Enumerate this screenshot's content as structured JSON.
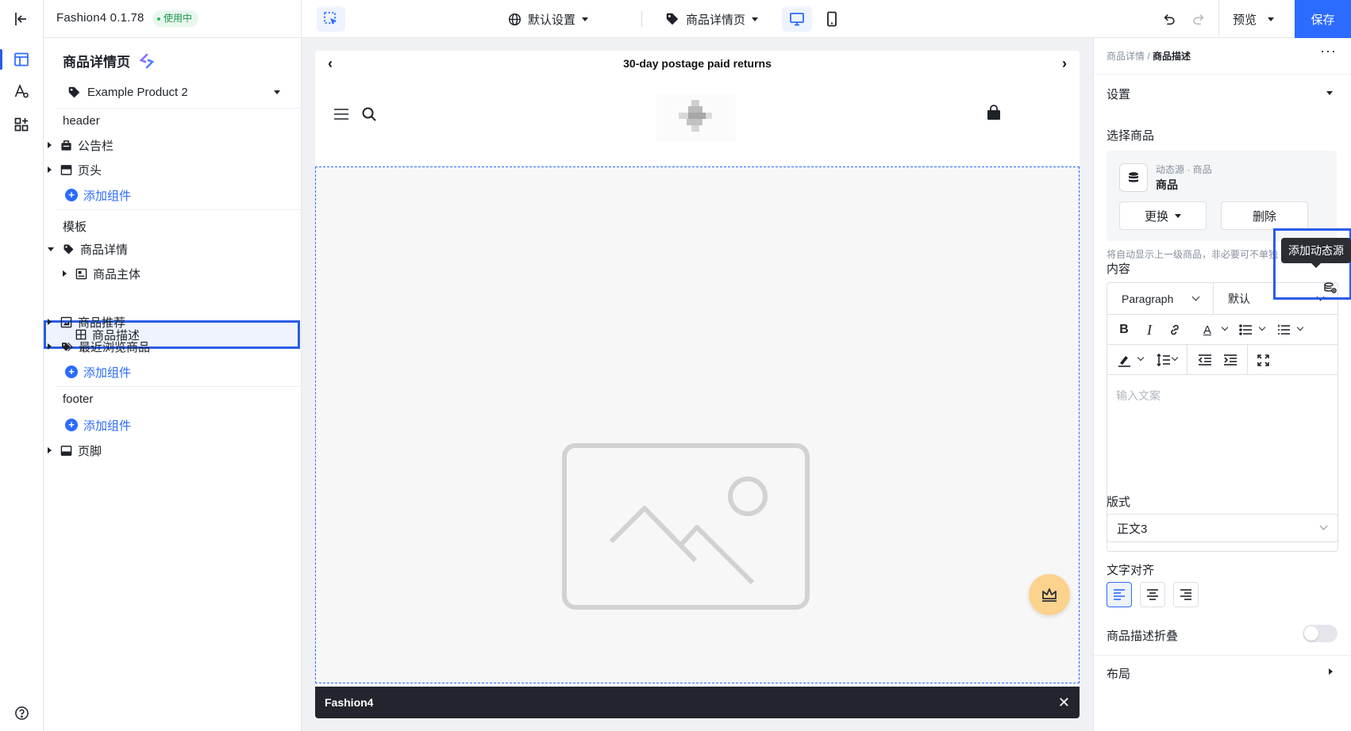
{
  "app": {
    "name": "Fashion4 0.1.78",
    "status": "使用中"
  },
  "toolbar": {
    "settings_label": "默认设置",
    "page_label": "商品详情页",
    "preview_label": "预览",
    "save_label": "保存"
  },
  "left_panel": {
    "title": "商品详情页",
    "product_select": "Example Product 2",
    "sections": {
      "header": {
        "title": "header",
        "items": [
          "公告栏",
          "页头"
        ],
        "add_label": "添加组件"
      },
      "template": {
        "title": "模板",
        "root": "商品详情",
        "children": [
          "商品主体",
          "商品描述"
        ],
        "siblings": [
          "商品推荐",
          "最近浏览商品"
        ],
        "add_label": "添加组件"
      },
      "footer": {
        "title": "footer",
        "add_label": "添加组件",
        "items": [
          "页脚"
        ]
      }
    }
  },
  "canvas": {
    "announcement": "30-day postage paid returns",
    "footer_brand": "Fashion4"
  },
  "right_panel": {
    "breadcrumb_parent": "商品详情",
    "breadcrumb_sep": "/",
    "breadcrumb_current": "商品描述",
    "settings_title": "设置",
    "select_product_label": "选择商品",
    "source_kind": "动态源 · 商品",
    "source_value": "商品",
    "replace_label": "更换",
    "delete_label": "删除",
    "hint": "将自动显示上一级商品，非必要可不单独",
    "tooltip": "添加动态源",
    "content_label": "内容",
    "block_type": "Paragraph",
    "font_default": "默认",
    "editor_placeholder": "输入文案",
    "style_label": "版式",
    "style_value": "正文3",
    "align_label": "文字对齐",
    "collapse_label": "商品描述折叠",
    "layout_label": "布局"
  },
  "colors": {
    "accent": "#2b6bff",
    "highlight": "#2b5ce6",
    "footer_bg": "#23252e",
    "fab": "#fbd38d"
  }
}
